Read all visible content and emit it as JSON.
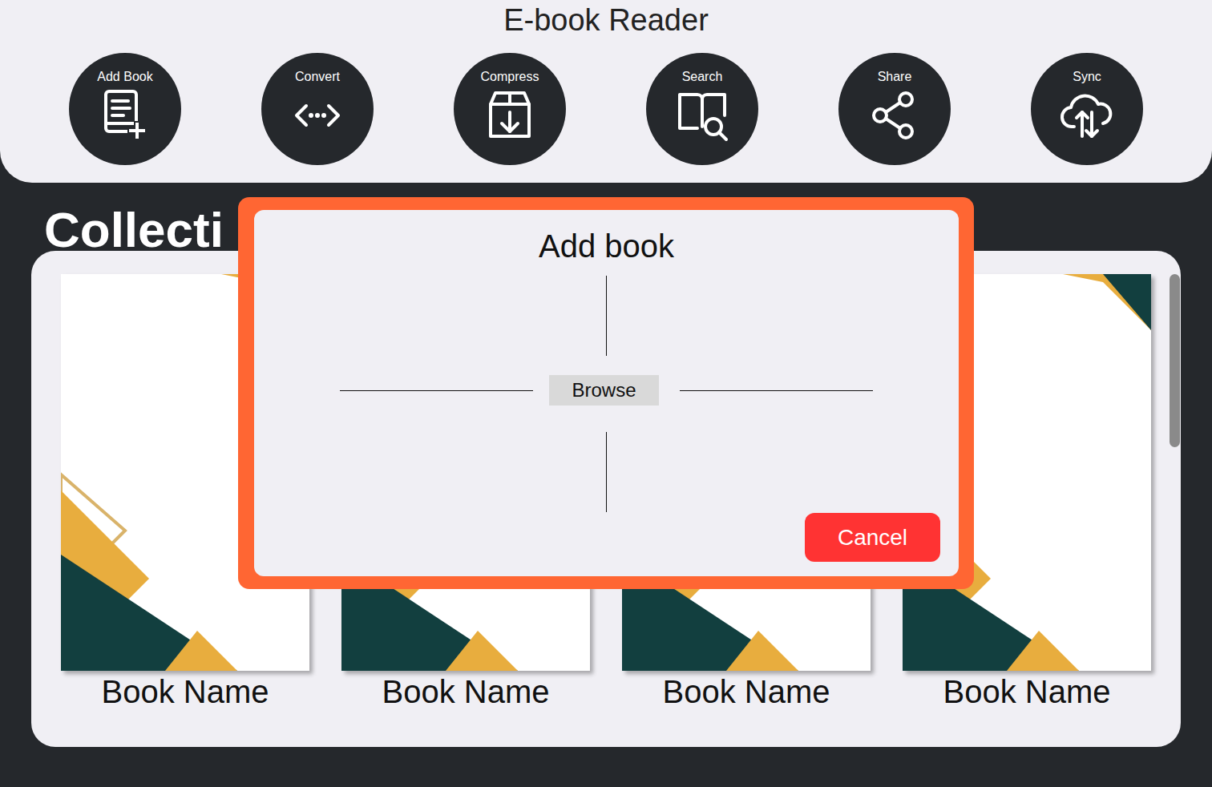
{
  "window": {
    "title": "E-book Reader"
  },
  "toolbar": [
    {
      "label": "Add Book"
    },
    {
      "label": "Convert"
    },
    {
      "label": "Compress"
    },
    {
      "label": "Search"
    },
    {
      "label": "Share"
    },
    {
      "label": "Sync"
    }
  ],
  "collection": {
    "heading": "Collecti",
    "books": [
      {
        "name": "Book Name"
      },
      {
        "name": "Book Name"
      },
      {
        "name": "Book Name"
      },
      {
        "name": "Book Name"
      }
    ]
  },
  "dialog": {
    "title": "Add book",
    "browse": "Browse",
    "cancel": "Cancel"
  }
}
